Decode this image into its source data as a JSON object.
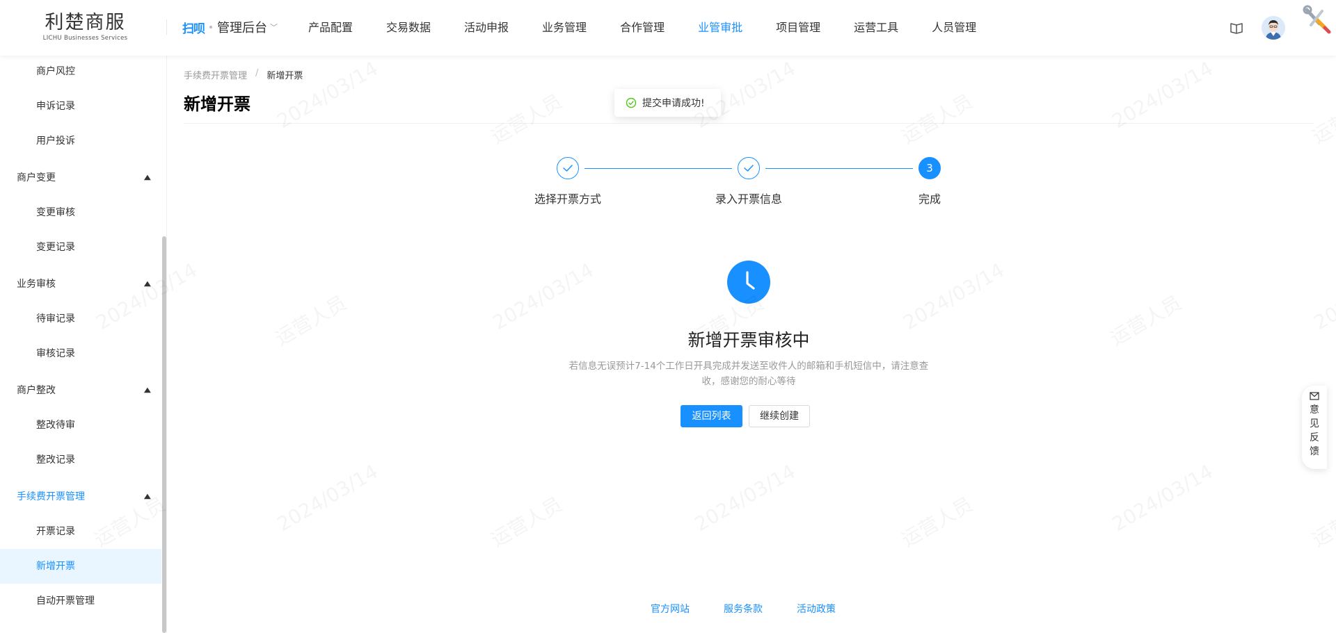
{
  "header": {
    "logo_main": "利楚商服",
    "logo_sub": "LICHU Businesses Services",
    "brand_mark": "扫呗",
    "brand_title": "管理后台",
    "nav": [
      "产品配置",
      "交易数据",
      "活动申报",
      "业务管理",
      "合作管理",
      "业管审批",
      "项目管理",
      "运营工具",
      "人员管理"
    ],
    "active_nav": "业管审批"
  },
  "sidebar": {
    "items": [
      {
        "label": "商户风控",
        "type": "sub"
      },
      {
        "label": "申诉记录",
        "type": "sub"
      },
      {
        "label": "用户投诉",
        "type": "sub"
      },
      {
        "label": "商户变更",
        "type": "group"
      },
      {
        "label": "变更审核",
        "type": "sub"
      },
      {
        "label": "变更记录",
        "type": "sub"
      },
      {
        "label": "业务审核",
        "type": "group"
      },
      {
        "label": "待审记录",
        "type": "sub"
      },
      {
        "label": "审核记录",
        "type": "sub"
      },
      {
        "label": "商户整改",
        "type": "group"
      },
      {
        "label": "整改待审",
        "type": "sub"
      },
      {
        "label": "整改记录",
        "type": "sub"
      },
      {
        "label": "手续费开票管理",
        "type": "group"
      },
      {
        "label": "开票记录",
        "type": "sub"
      },
      {
        "label": "新增开票",
        "type": "sub"
      },
      {
        "label": "自动开票管理",
        "type": "sub"
      }
    ]
  },
  "breadcrumb": {
    "parent": "手续费开票管理",
    "separator": "/",
    "current": "新增开票"
  },
  "page_title": "新增开票",
  "toast": {
    "message": "提交申请成功!"
  },
  "steps": [
    {
      "label": "选择开票方式",
      "status": "done"
    },
    {
      "label": "录入开票信息",
      "status": "done"
    },
    {
      "label": "完成",
      "status": "current",
      "number": "3"
    }
  ],
  "result": {
    "title": "新增开票审核中",
    "description": "若信息无误预计7-14个工作日开具完成并发送至收件人的邮箱和手机短信中，请注意查收，感谢您的耐心等待",
    "primary_button": "返回列表",
    "secondary_button": "继续创建"
  },
  "footer": {
    "links": [
      "官方网站",
      "服务条款",
      "活动政策"
    ]
  },
  "feedback": {
    "label": "意见反馈"
  },
  "watermark": {
    "name": "运营人员",
    "date": "2024/03/14"
  },
  "colors": {
    "accent": "#1890ff",
    "selected_bg": "#e9f5ff",
    "success": "#52c41a"
  }
}
